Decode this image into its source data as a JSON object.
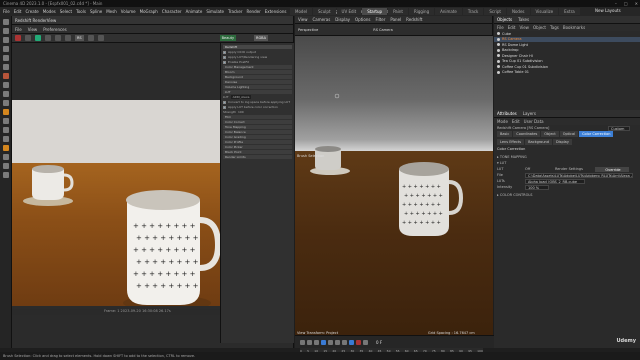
{
  "window": {
    "title": "Cinema 4D 2023.1.0 - [Espfx001_02.c4d *] - Main"
  },
  "menubar": {
    "items": [
      "File",
      "Edit",
      "Create",
      "Modes",
      "Select",
      "Tools",
      "Spline",
      "Mesh",
      "Volume",
      "MoGraph",
      "Character",
      "Animate",
      "Simulate",
      "Tracker",
      "Render",
      "Extensions",
      "WINDOWS",
      "Greyscalegorilla",
      "Octane",
      "Pixel",
      "Help"
    ]
  },
  "layout_tabs": [
    {
      "label": "Model",
      "active": false
    },
    {
      "label": "Sculpt",
      "active": false
    },
    {
      "label": "UV Edit",
      "active": false
    },
    {
      "label": "Startup",
      "active": true
    },
    {
      "label": "Paint",
      "active": false
    },
    {
      "label": "Rigging",
      "active": false
    },
    {
      "label": "Animate",
      "active": false
    },
    {
      "label": "Track",
      "active": false
    },
    {
      "label": "Script",
      "active": false
    },
    {
      "label": "Nodes",
      "active": false
    },
    {
      "label": "Visualize",
      "active": false
    },
    {
      "label": "Extra",
      "active": false
    }
  ],
  "new_layouts": "New Layouts",
  "renderview": {
    "title": "Redshift RenderView",
    "menu": [
      "File",
      "View",
      "Preferences"
    ],
    "badge_left": "RS",
    "badge_mid": "Beauty",
    "badge_right": "RGBA",
    "frame_info": "Frame: 1  2023-09-20  16:30:08  26.17s",
    "settings_header": "Redshift",
    "checks": [
      "Apply OCIO output",
      "Apply LUT/Rendering view",
      "Enable PostFX"
    ],
    "sections": [
      "Color Management",
      "Bloom",
      "Background",
      "Denoise",
      "Volume Lighting",
      "LUT",
      "Film",
      "Color Correct",
      "Tone Mapping",
      "Color Balance",
      "Color Grading",
      "Color Profile",
      "Color Picker",
      "Black Point",
      "Render Limits"
    ],
    "lut_row": {
      "label": "LUT",
      "value": "ARRI_Alexa"
    },
    "lut_checks": [
      "Convert to log space before applying LUT",
      "Apply LUT before color correction"
    ],
    "lut_strength": {
      "label": "Strength",
      "value": "100"
    }
  },
  "viewport": {
    "menu": [
      "View",
      "Cameras",
      "Display",
      "Options",
      "Filter",
      "Panel",
      "Redshift"
    ],
    "name": "Perspective",
    "camera": "RS Camera",
    "brush_label": "Brush Selection",
    "transform_label": "View Transform: Project",
    "grid_spacing": "Grid Spacing : 16.7647 cm"
  },
  "timeline": {
    "start": "0 F",
    "end": "100 F",
    "current": "0 F",
    "scale": [
      "0",
      "5",
      "10",
      "15",
      "20",
      "25",
      "30",
      "35",
      "40",
      "45",
      "50",
      "55",
      "60",
      "65",
      "70",
      "75",
      "80",
      "85",
      "90",
      "95",
      "100"
    ]
  },
  "objects_panel": {
    "tabs": [
      "Objects",
      "Takes"
    ],
    "menu": [
      "File",
      "Edit",
      "View",
      "Object",
      "Tags",
      "Bookmarks"
    ],
    "items": [
      {
        "name": "Cube",
        "selected": false
      },
      {
        "name": "RS Camera",
        "selected": true
      },
      {
        "name": "RS Dome Light",
        "selected": false
      },
      {
        "name": "Backdrop",
        "selected": false
      },
      {
        "name": "Designer Chair HI",
        "selected": false
      },
      {
        "name": "Tea Cup 01 Subdivision",
        "selected": false
      },
      {
        "name": "Coffee Cup 01 Subdivision",
        "selected": false
      },
      {
        "name": "Coffee Table 01",
        "selected": false
      }
    ]
  },
  "attributes": {
    "tabs": [
      "Attributes",
      "Layers"
    ],
    "menu": [
      "Mode",
      "Edit",
      "User Data"
    ],
    "object_title": "Redshift Camera [RS Camera]",
    "preset": "Custom",
    "subtabs": [
      {
        "label": "Basic",
        "active": false
      },
      {
        "label": "Coordinates",
        "active": false
      },
      {
        "label": "Object",
        "active": false
      },
      {
        "label": "Optical",
        "active": false
      },
      {
        "label": "Color Correction",
        "active": true
      },
      {
        "label": "Lens Effects",
        "active": false
      },
      {
        "label": "Background",
        "active": false
      },
      {
        "label": "Display",
        "active": false
      }
    ],
    "section_title": "Color Correction",
    "tone_mapping": "TONE MAPPING",
    "lut": "LUT",
    "lut_col_off": "Off",
    "lut_col_render": "Render Settings",
    "lut_col_override": "Override",
    "file_label": "File",
    "file_value": "C:\\Data\\Assets\\LUTs\\Adobe\\LUTs\\Adoberp_RLUTs\\Arri\\Alexa_Arri_KK.cube",
    "luts_label": "LUTs",
    "luts_value": "Alpha Ipad_JOBS_2_RB.cube",
    "intensity_label": "Intensity",
    "intensity_value": "100 %",
    "color_controls": "COLOR CONTROLS",
    "watermark": "Udemy"
  },
  "statusbar": "Brush Selection: Click and drag to select elements. Hold down SHIFT to add to the selection, CTRL to remove."
}
